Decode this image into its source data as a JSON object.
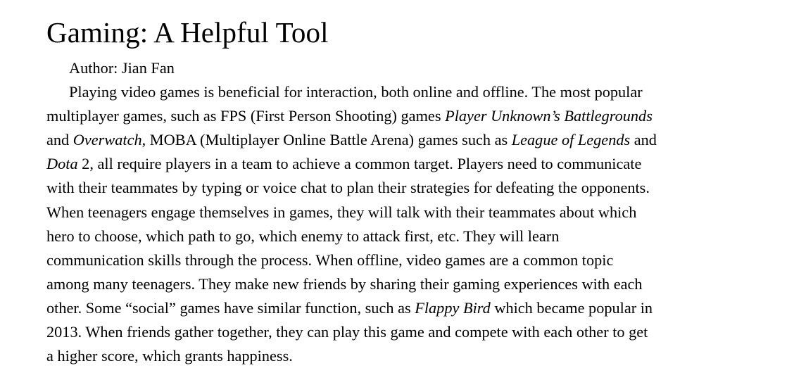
{
  "title": "Gaming: A Helpful Tool",
  "author": "Author: Jian Fan",
  "paragraph": {
    "l1": "Playing video games is beneficial for interaction, both online and offline. The most popular",
    "l2a": "multiplayer games, such as FPS (First Person Shooting) games ",
    "l2b": "Player Unknown’s Battlegrounds",
    "l3a": "and ",
    "l3b": "Overwatch",
    "l3c": ", MOBA (Multiplayer Online Battle Arena) games such as ",
    "l3d": "League of Legends",
    "l3e": " and",
    "l4a": "Dota",
    "l4b": " 2, all require players in a team to achieve a common target. Players need to communicate",
    "l5": "with their teammates by typing or voice chat to plan their strategies for defeating the opponents.",
    "l6": "When teenagers engage themselves in games, they will talk with their teammates about which",
    "l7": "hero to choose, which path to go, which enemy to attack first, etc. They will learn",
    "l8": "communication skills through the process. When offline, video games are a common topic",
    "l9": "among many teenagers. They make new friends by sharing their gaming experiences with each",
    "l10a": "other. Some “social” games have similar function, such as ",
    "l10b": "Flappy Bird",
    "l10c": " which became popular in",
    "l11": "2013. When friends gather together, they can play this game and compete with each other to get",
    "l12": "a higher score, which grants happiness."
  }
}
